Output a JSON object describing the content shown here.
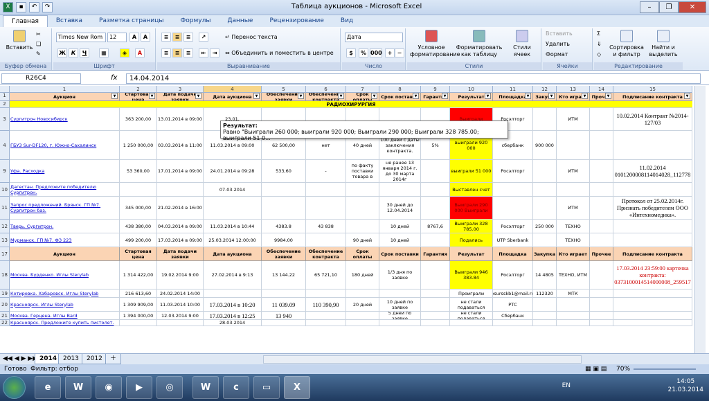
{
  "window": {
    "title": "Таблица аукционов - Microsoft Excel"
  },
  "ribbon_tabs": [
    "Главная",
    "Вставка",
    "Разметка страницы",
    "Формулы",
    "Данные",
    "Рецензирование",
    "Вид"
  ],
  "ribbon": {
    "paste": "Вставить",
    "font_name": "Times New Rom",
    "font_size": "12",
    "bold": "Ж",
    "italic": "К",
    "underline": "Ч",
    "wrap": "Перенос текста",
    "merge": "Объединить и поместить в центре",
    "number_format": "Дата",
    "percent": "%",
    "thousands": "000",
    "cond_format": "Условное форматирование",
    "format_table": "Форматировать как таблицу",
    "cell_styles": "Стили ячеек",
    "insert": "Вставить",
    "delete": "Удалить",
    "format": "Формат",
    "sort": "Сортировка и фильтр",
    "find": "Найти и выделить",
    "groups": {
      "clipboard": "Буфер обмена",
      "font": "Шрифт",
      "alignment": "Выравнивание",
      "number": "Число",
      "styles": "Стили",
      "cells": "Ячейки",
      "editing": "Редактирование"
    }
  },
  "formula_bar": {
    "name_box": "R26C4",
    "fx": "fx",
    "value": "14.04.2014"
  },
  "columns": [
    "1",
    "2",
    "3",
    "4",
    "5",
    "6",
    "7",
    "8",
    "9",
    "10",
    "11",
    "12",
    "13",
    "14",
    "15"
  ],
  "headers": [
    "Аукцион",
    "Стартовая цена",
    "Дата подачи заявки",
    "Дата аукциона",
    "Обеспечение заявки",
    "Обеспечение контракта",
    "Срок оплаты",
    "Срок поставки",
    "Гарантия",
    "Результат",
    "Площадка",
    "Закупк",
    "Кто играет",
    "Прочее",
    "Подписание контракта"
  ],
  "band": "РАДИОХИРУРГИЯ",
  "rows": [
    {
      "n": "3",
      "c": [
        "Сургитрон Новосибирск",
        "363 200,00",
        "13.01.2014 в 09:00",
        "23.01.",
        "",
        "",
        "",
        "",
        "",
        "Выиграли",
        "Росэлторг",
        "",
        "ИТМ",
        "",
        "10.02.2014 Контракт №2014-127/03"
      ]
    },
    {
      "n": "4",
      "c": [
        "ГБУЗ Sur-DF120, г. Южно-Сахалинск",
        "1 250 000,00",
        "03.03.2014 в 11:00",
        "11.03.2014 в 09:00",
        "62 500,00",
        "нет",
        "40 дней",
        "100 дней с даты заключения контракта.",
        "5%",
        "выиграли 920 000",
        "сбербанк",
        "900 000",
        "",
        "",
        ""
      ]
    },
    {
      "n": "9",
      "c": [
        "Уфа. Расходка",
        "53 360,00",
        "17.01.2014 в 09:00",
        "24.01.2014 в 09:28",
        "533,60",
        "-",
        "по факту поставки товара в",
        "не ранее 13 января 2014 г. до 30 марта 2014г",
        "",
        "выиграли 51 000",
        "Росэлторг",
        "",
        "ИТМ",
        "",
        "11.02.2014 0101200008114014028_112778"
      ]
    },
    {
      "n": "10",
      "c": [
        "Дагестан. Предложите победителю Сургитрон.",
        "",
        "",
        "07.03.2014",
        "",
        "",
        "",
        "",
        "",
        "Выставлен счет",
        "",
        "",
        "",
        "",
        ""
      ]
    },
    {
      "n": "11",
      "c": [
        "Запрос предложений. Брянск. ГП №7. Сургитрон баз.",
        "345 000,00",
        "21.02.2014 в 16:00",
        "",
        "",
        "",
        "",
        "30 дней до 12.04.2014",
        "",
        "Выиграли 290 000 Выиграли",
        "",
        "",
        "ИТМ",
        "",
        "Протокол от 25.02.2014г. Признать победителем ООО «Интехномедика»."
      ]
    },
    {
      "n": "12",
      "c": [
        "Тверь. Сургитрон.",
        "438 380,00",
        "04.03.2014 в 09:00",
        "11.03.2014 в 10:44",
        "4383.8",
        "43 838",
        "",
        "10 дней",
        "8767,6",
        "Выиграли 328 785.00",
        "Росэлторг",
        "250 000",
        "ТЕХНО",
        "",
        ""
      ]
    },
    {
      "n": "13",
      "c": [
        "Мурманск. ГП №7. ФЗ 223",
        "499 200,00",
        "17.03.2014 в 09:00",
        "25.03.2014 12:00:00",
        "9984.00",
        "",
        "90 дней",
        "10 дней",
        "",
        "Подались",
        "UTP Sberbank",
        "",
        "ТЕХНО",
        "",
        ""
      ]
    },
    {
      "n": "17",
      "c": [
        "Аукцион",
        "Стартовая цена",
        "Дата подачи заявки",
        "Дата аукциона",
        "Обеспечение заявки",
        "Обеспечение контракта",
        "Срок оплаты",
        "Срок поставки",
        "Гарантия",
        "Результат",
        "Площадка",
        "Закупка",
        "Кто играет",
        "Прочее",
        "Подписание контракта"
      ]
    },
    {
      "n": "18",
      "c": [
        "Москва. Бурденко. Иглы Sterylab",
        "1 314 422,00",
        "19.02.2014 9:00",
        "27.02.2014 в 9:13",
        "13 144.22",
        "65 721,10",
        "180 дней",
        "1/3 дня по заявке",
        "",
        "Выиграли 946 383.84",
        "Росэлторг",
        "14 4805",
        "ТЕХНО, ИТМ",
        "",
        "17.03.2014 23:59:00 карточка контракта: 0373100014514000008_259517"
      ]
    },
    {
      "n": "19",
      "c": [
        "Котировка. Хабаровск. Иглы Sterylab",
        "216 613,60",
        "24.02.2014 14:00",
        "",
        "",
        "",
        "",
        "",
        "",
        "Проиграли",
        "esursskb1@mail.ru",
        "112320",
        "МТК",
        "",
        ""
      ]
    },
    {
      "n": "20",
      "c": [
        "Красноярск. Иглы Sterylab",
        "1 309 909,00",
        "11.03.2014 10:00",
        "17.03.2014 в 10:20",
        "11 039.09",
        "110 390,90",
        "20 дней",
        "10 дней по заявке",
        "",
        "не стали подаваться",
        "РТС",
        "",
        "",
        "",
        ""
      ]
    },
    {
      "n": "21",
      "c": [
        "Москва. Герцена. Иглы Bard",
        "1 394 000,00",
        "12.03.2014 9:00",
        "17.03.2014 в 12:25",
        "13 940",
        "",
        "",
        "5 дней по заявке",
        "",
        "не стали подаваться",
        "Сбербанк",
        "",
        "",
        "",
        ""
      ]
    },
    {
      "n": "22",
      "c": [
        "Красноярск. Предложите купить пистолет.",
        "",
        "",
        "28.03.2014",
        "",
        "",
        "",
        "",
        "",
        "",
        "",
        "",
        "",
        "",
        ""
      ]
    }
  ],
  "row_labels": [
    "1",
    "2"
  ],
  "tooltip": {
    "title": "Результат:",
    "text": "Равно \"Выиграли 260 000; выиграли 920 000; Выиграли 290 000; Выиграли 328 785.00; выиграли 51 0..."
  },
  "sheet_tabs": [
    "2014",
    "2013",
    "2012"
  ],
  "status": {
    "ready": "Готово",
    "filter": "Фильтр: отбор",
    "zoom": "70%"
  },
  "tray": {
    "lang": "EN",
    "time": "14:05",
    "date": "21.03.2014"
  }
}
